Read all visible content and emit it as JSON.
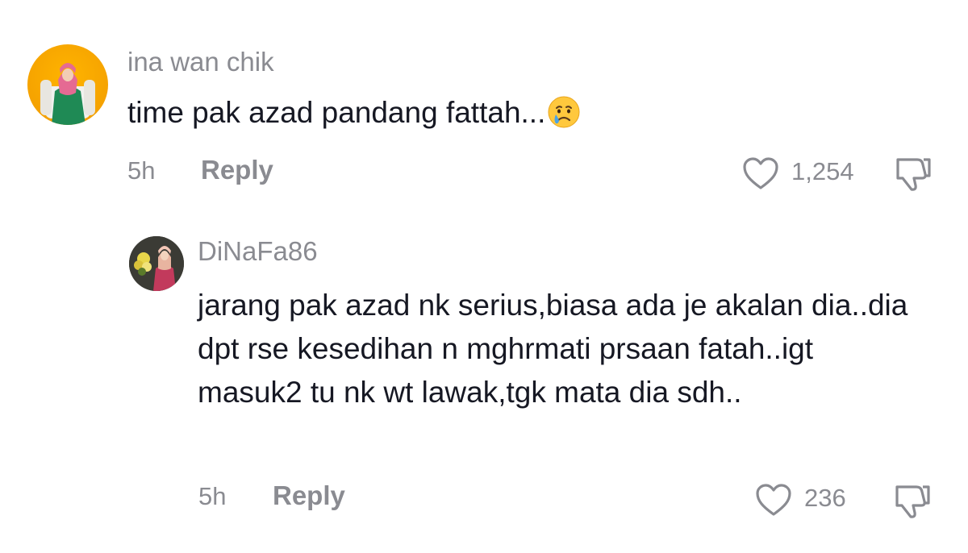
{
  "comments": [
    {
      "username": "ina wan chik",
      "text": "time pak azad pandang fattah...",
      "emoji": "crying-face",
      "time": "5h",
      "reply_label": "Reply",
      "likes": "1,254"
    },
    {
      "username": "DiNaFa86",
      "text": "jarang pak azad nk serius,biasa ada je akalan dia..dia dpt rse kesedihan n mghrmati prsaan fatah..igt masuk2 tu nk wt lawak,tgk mata dia sdh..",
      "time": "5h",
      "reply_label": "Reply",
      "likes": "236"
    }
  ],
  "colors": {
    "text_primary": "#161823",
    "text_secondary": "#8a8b91",
    "avatar1_bg": "#f5a200",
    "avatar2_bg": "#3b3b35"
  },
  "icons": {
    "like": "heart-outline-icon",
    "dislike": "thumbs-down-outline-icon"
  }
}
